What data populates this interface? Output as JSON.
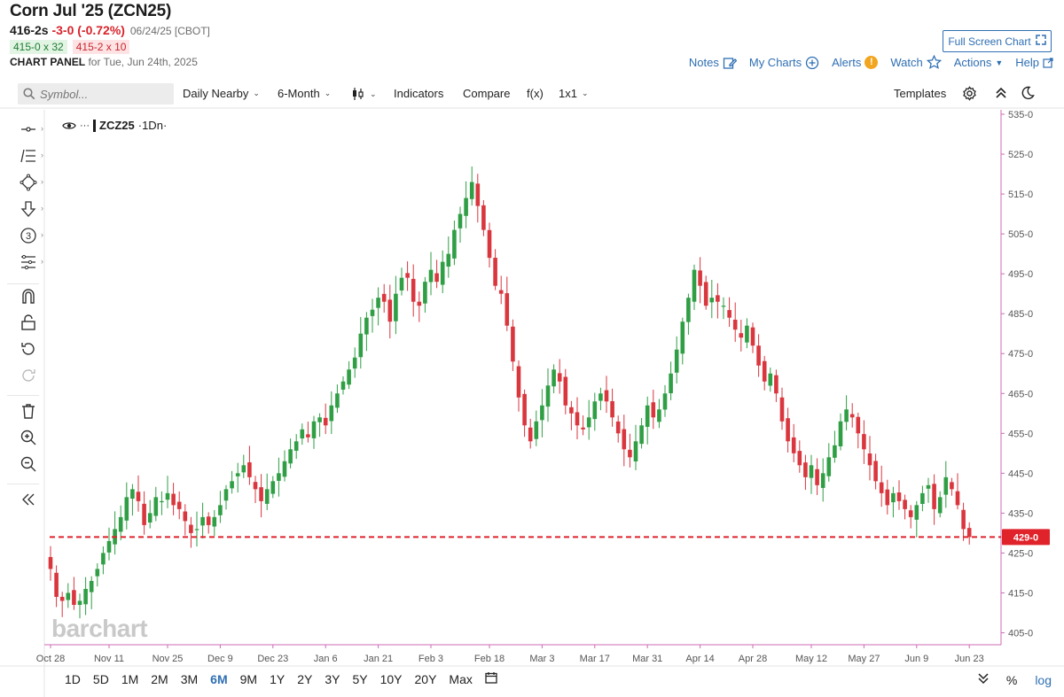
{
  "header": {
    "title": "Corn Jul '25 (ZCN25)",
    "last": "416-2s",
    "change": "-3-0 (-0.72%)",
    "date_exchange": "06/24/25 [CBOT]",
    "bid": "415-0 x 32",
    "ask": "415-2 x 10",
    "panel_label": "CHART PANEL",
    "panel_for": "for Tue, Jun 24th, 2025"
  },
  "top_links": {
    "full_screen": "Full Screen Chart",
    "notes": "Notes",
    "my_charts": "My Charts",
    "alerts": "Alerts",
    "watch": "Watch",
    "actions": "Actions",
    "help": "Help"
  },
  "toolbar": {
    "search_placeholder": "Symbol...",
    "daily_nearby": "Daily Nearby",
    "period": "6-Month",
    "indicators": "Indicators",
    "compare": "Compare",
    "fx": "f(x)",
    "layout": "1x1",
    "templates": "Templates"
  },
  "left_tools": [
    "crosshair-icon",
    "trend-list-icon",
    "shapes-icon",
    "arrow-down-icon",
    "counter-icon",
    "fib-icon",
    "magnet-icon",
    "unlock-icon",
    "undo-icon",
    "redo-icon",
    "trash-icon",
    "zoom-in-icon",
    "zoom-out-icon",
    "collapse-icon"
  ],
  "legend": {
    "symbol": "ZCZ25",
    "interval": "1Dn"
  },
  "watermark": "barchart",
  "periods": [
    "1D",
    "5D",
    "1M",
    "2M",
    "3M",
    "6M",
    "9M",
    "1Y",
    "2Y",
    "3Y",
    "5Y",
    "10Y",
    "20Y",
    "Max"
  ],
  "active_period": "6M",
  "bottom_right": {
    "percent": "%",
    "log": "log"
  },
  "colors": {
    "up": "#2f9e44",
    "down": "#d9363e",
    "accent": "#2f6fb3",
    "axis": "#cc6bb5"
  },
  "chart_data": {
    "type": "candlestick",
    "symbol": "ZCZ25",
    "y_ticks": [
      "535-0",
      "525-0",
      "515-0",
      "505-0",
      "495-0",
      "485-0",
      "475-0",
      "465-0",
      "455-0",
      "445-0",
      "435-0",
      "425-0",
      "415-0",
      "405-0"
    ],
    "y_tick_values": [
      535,
      525,
      515,
      505,
      495,
      485,
      475,
      465,
      455,
      445,
      435,
      425,
      415,
      405
    ],
    "ylim": [
      402,
      537
    ],
    "x_labels": [
      "Oct 28",
      "Nov 11",
      "Nov 25",
      "Dec 9",
      "Dec 23",
      "Jan 6",
      "Jan 21",
      "Feb 3",
      "Feb 18",
      "Mar 3",
      "Mar 17",
      "Mar 31",
      "Apr 14",
      "Apr 28",
      "May 12",
      "May 27",
      "Jun 9",
      "Jun 23"
    ],
    "x_label_indices": [
      0,
      10,
      20,
      29,
      38,
      47,
      56,
      65,
      75,
      84,
      93,
      102,
      111,
      120,
      130,
      139,
      148,
      157
    ],
    "current_price_label": "429-0",
    "current_price": 429,
    "closes": [
      421,
      414,
      413,
      415,
      412,
      413,
      416,
      418,
      421,
      425,
      428,
      431,
      434,
      439,
      441,
      438,
      432,
      435,
      439,
      438,
      440,
      437,
      436,
      433,
      430,
      431,
      434,
      432,
      434,
      437,
      441,
      443,
      445,
      447,
      444,
      441,
      438,
      441,
      443,
      445,
      448,
      451,
      453,
      456,
      454,
      458,
      459,
      457,
      462,
      465,
      468,
      471,
      474,
      480,
      484,
      486,
      489,
      488,
      483,
      490,
      494,
      494,
      488,
      487,
      493,
      496,
      493,
      498,
      500,
      506,
      510,
      514,
      518,
      512,
      506,
      499,
      492,
      490,
      482,
      473,
      464,
      457,
      453,
      458,
      462,
      467,
      471,
      468,
      462,
      460,
      457,
      456,
      459,
      463,
      465,
      463,
      459,
      455,
      451,
      449,
      453,
      457,
      462,
      459,
      461,
      465,
      470,
      476,
      483,
      489,
      496,
      492,
      487,
      489,
      488,
      487,
      484,
      481,
      479,
      482,
      477,
      472,
      468,
      470,
      465,
      458,
      453,
      450,
      447,
      444,
      447,
      442,
      445,
      449,
      452,
      458,
      461,
      459,
      455,
      451,
      447,
      443,
      440,
      437,
      440,
      438,
      436,
      434,
      437,
      440,
      442,
      436,
      439,
      444,
      441,
      437,
      431,
      429
    ]
  }
}
